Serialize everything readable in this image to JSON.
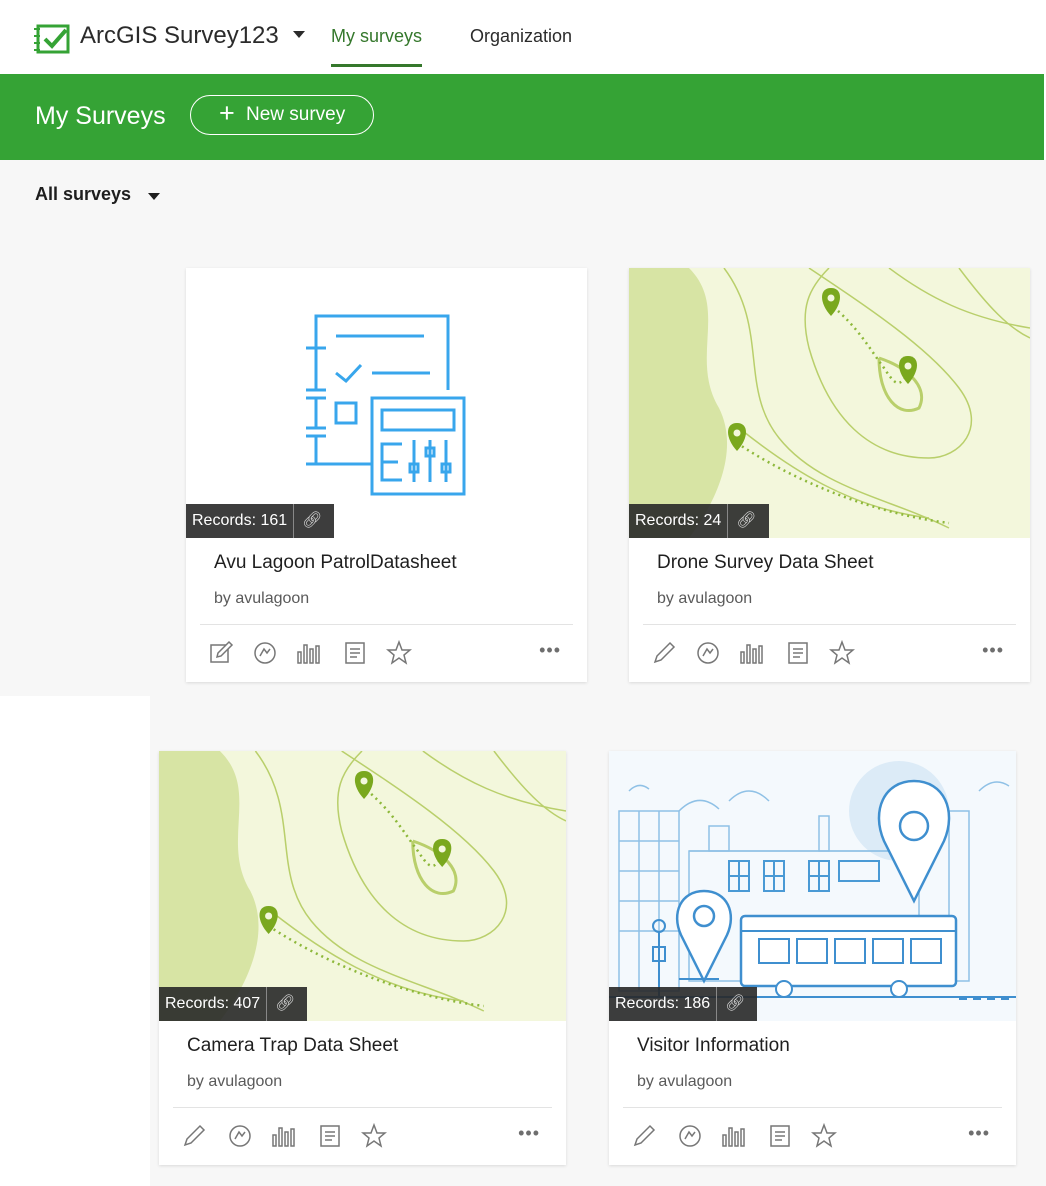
{
  "app": {
    "name": "ArcGIS Survey123",
    "brand_color": "#35a335",
    "accent_color": "#35782c"
  },
  "nav": {
    "tabs": [
      {
        "label": "My surveys",
        "active": true
      },
      {
        "label": "Organization",
        "active": false
      }
    ]
  },
  "banner": {
    "title": "My Surveys",
    "new_button_label": "New survey",
    "new_button_icon": "plus-icon"
  },
  "filter": {
    "label": "All surveys",
    "icon": "caret-down-icon"
  },
  "surveys": [
    {
      "title": "Avu Lagoon PatrolDatasheet",
      "owner": "by avulagoon",
      "records": "Records: 161",
      "thumbnail": "form-illustration",
      "actions": [
        "edit-icon",
        "collect-icon",
        "analyze-icon",
        "data-icon",
        "favorite-icon"
      ]
    },
    {
      "title": "Drone Survey Data Sheet",
      "owner": "by avulagoon",
      "records": "Records: 24",
      "thumbnail": "topographic-map",
      "actions": [
        "edit-icon",
        "collect-icon",
        "analyze-icon",
        "data-icon",
        "favorite-icon"
      ]
    },
    {
      "title": "Camera Trap Data Sheet",
      "owner": "by avulagoon",
      "records": "Records: 407",
      "thumbnail": "topographic-map",
      "actions": [
        "edit-icon",
        "collect-icon",
        "analyze-icon",
        "data-icon",
        "favorite-icon"
      ]
    },
    {
      "title": "Visitor Information",
      "owner": "by avulagoon",
      "records": "Records: 186",
      "thumbnail": "city-bus-illustration",
      "actions": [
        "edit-icon",
        "collect-icon",
        "analyze-icon",
        "data-icon",
        "favorite-icon"
      ]
    }
  ],
  "more_label": "•••"
}
